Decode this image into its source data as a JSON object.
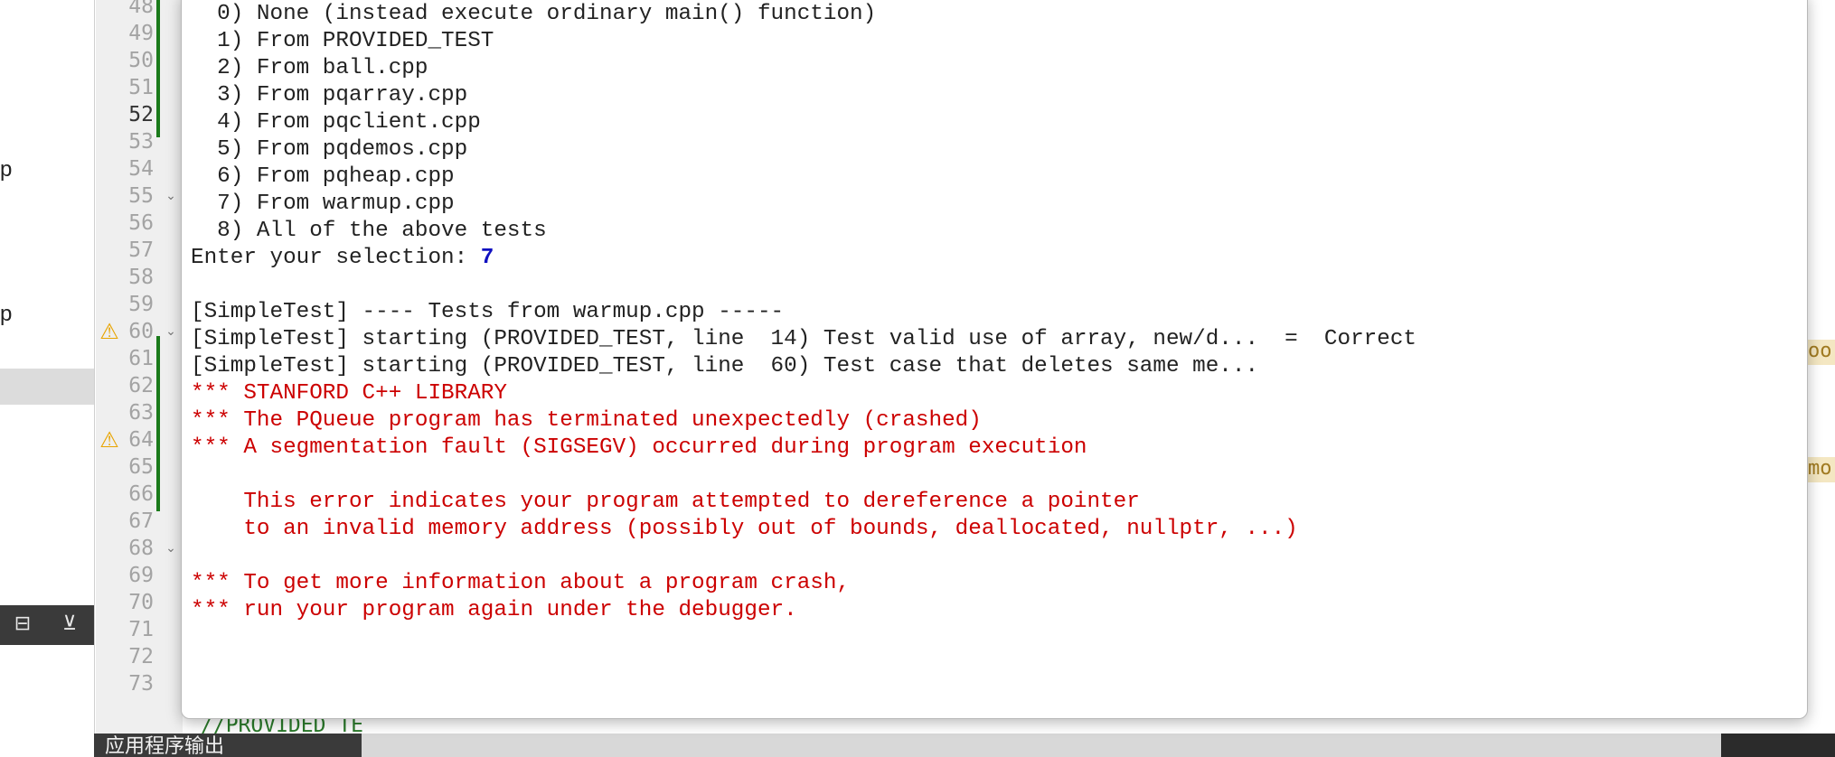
{
  "sidebar": {
    "fragments": [
      "p",
      "p"
    ],
    "toolbar": {
      "split_icon": "split-add-icon",
      "collapse_icon": "collapse-panel-icon"
    }
  },
  "gutter": {
    "line_numbers": [
      "48",
      "49",
      "50",
      "51",
      "52",
      "53",
      "54",
      "55",
      "56",
      "57",
      "58",
      "59",
      "60",
      "61",
      "62",
      "63",
      "64",
      "65",
      "66",
      "67",
      "68",
      "69",
      "70",
      "71",
      "72",
      "73"
    ],
    "current_line": "52",
    "warning_lines": [
      "60",
      "64"
    ],
    "fold_lines": [
      "55",
      "60",
      "68"
    ],
    "warning_icon": "warning-triangle-icon",
    "fold_icon": "chevron-down-icon"
  },
  "editor": {
    "peek_text": "//PROVIDED_TE",
    "edge_fragments": [
      "oo",
      "mo"
    ]
  },
  "output_bar": {
    "label": "应用程序输出"
  },
  "console": {
    "menu_lines": [
      "  0) None (instead execute ordinary main() function)",
      "  1) From PROVIDED_TEST",
      "  2) From ball.cpp",
      "  3) From pqarray.cpp",
      "  4) From pqclient.cpp",
      "  5) From pqdemos.cpp",
      "  6) From pqheap.cpp",
      "  7) From warmup.cpp",
      "  8) All of the above tests"
    ],
    "prompt": "Enter your selection: ",
    "selection": "7",
    "test_lines": [
      "[SimpleTest] ---- Tests from warmup.cpp -----",
      "[SimpleTest] starting (PROVIDED_TEST, line  14) Test valid use of array, new/d...  =  Correct",
      "[SimpleTest] starting (PROVIDED_TEST, line  60) Test case that deletes same me..."
    ],
    "error_lines": [
      "*** STANFORD C++ LIBRARY",
      "*** The PQueue program has terminated unexpectedly (crashed)",
      "*** A segmentation fault (SIGSEGV) occurred during program execution",
      "",
      "    This error indicates your program attempted to dereference a pointer",
      "    to an invalid memory address (possibly out of bounds, deallocated, nullptr, ...)",
      "",
      "*** To get more information about a program crash,",
      "*** run your program again under the debugger."
    ]
  },
  "colors": {
    "error_text": "#cc0000",
    "selection_text": "#1010c0",
    "change_bar": "#1a7a1a",
    "warning": "#e8a400"
  }
}
